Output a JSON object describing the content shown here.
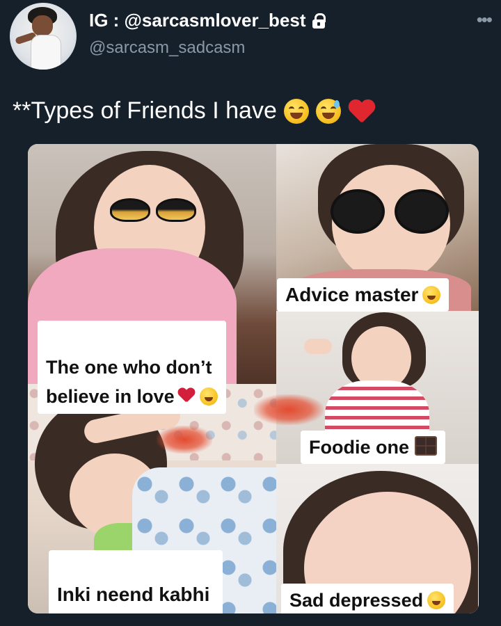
{
  "header": {
    "name": "IG : @sarcasmlover_best",
    "handle": "@sarcasm_sadcasm",
    "verified_icon": "lock-icon",
    "more_icon": "more-icon"
  },
  "tweet": {
    "text": "**Types of Friends I have",
    "emojis": [
      "grinning-squinting-face",
      "grinning-face-with-sweat",
      "red-heart"
    ]
  },
  "captions": {
    "advice": "Advice master",
    "love": "The one who don’t\nbelieve in love",
    "foodie": "Foodie one",
    "sleep": "Inki neend kabhi\npuri nahin hoti",
    "sad": "Sad depressed"
  },
  "colors": {
    "background": "#15202b",
    "secondary_text": "#8b98a5"
  }
}
